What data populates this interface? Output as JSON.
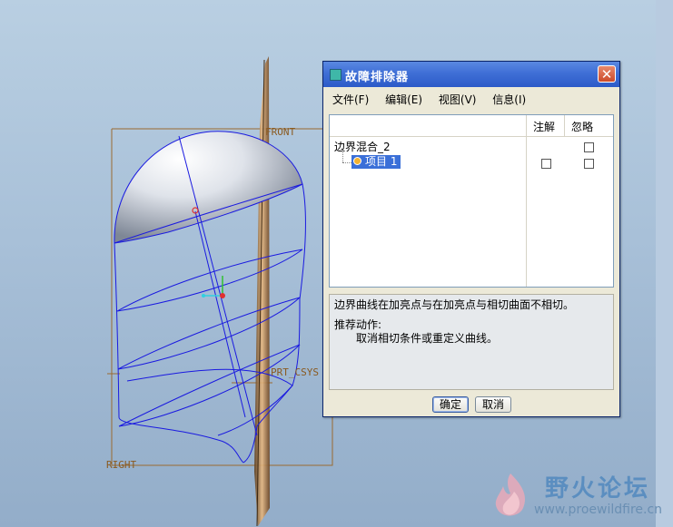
{
  "viewport": {
    "datum_labels": {
      "front": "FRONT",
      "prt_csys": "PRT_CSYS",
      "right": "RIGHT"
    }
  },
  "dialog": {
    "title": "故障排除器",
    "close_glyph": "✕",
    "menu": [
      "文件(F)",
      "编辑(E)",
      "视图(V)",
      "信息(I)"
    ],
    "columns": {
      "annotate": "注解",
      "ignore": "忽略"
    },
    "tree": {
      "root": "边界混合_2",
      "child": "项目 1"
    },
    "message": {
      "line1": "边界曲线在加亮点与在加亮点与相切曲面不相切。",
      "heading": "推荐动作:",
      "action": "取消相切条件或重定义曲线。"
    },
    "ok_label": "确定",
    "cancel_label": "取消"
  },
  "watermark": {
    "name": "野火论坛",
    "url": "www.proewildfire.cn"
  },
  "colors": {
    "curve": "#1a1ae0",
    "datum": "#a0702a",
    "titlebar": "#3f6fd6"
  }
}
